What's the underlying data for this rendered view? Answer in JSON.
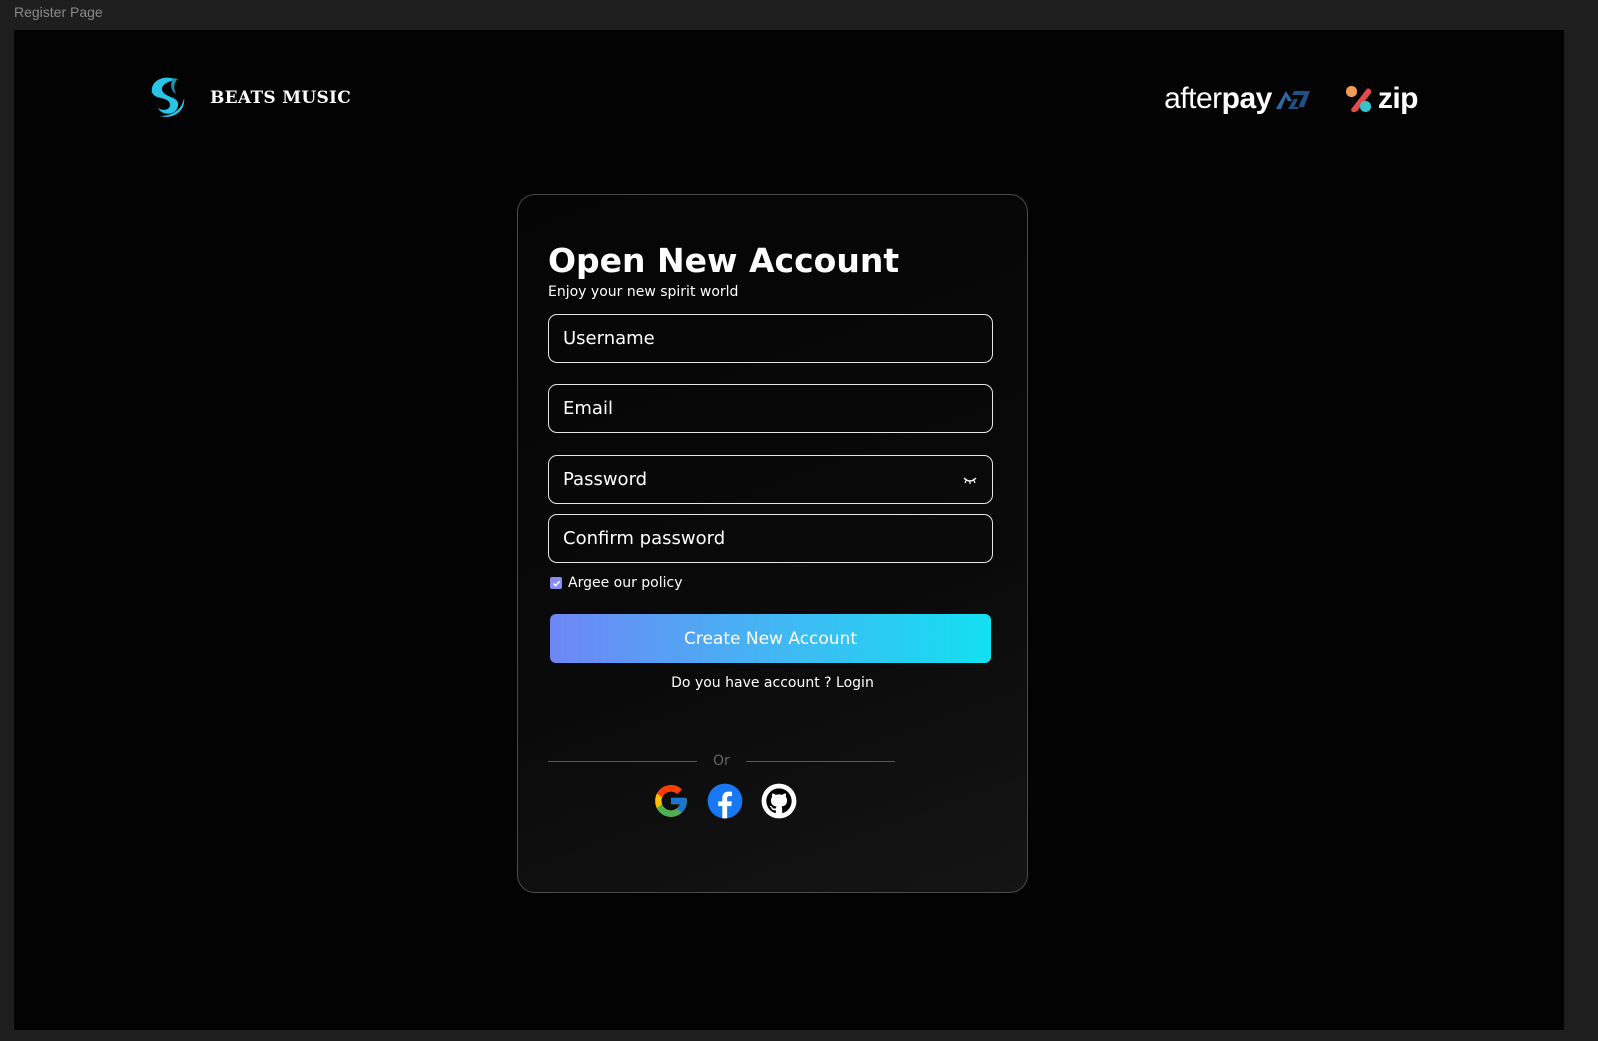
{
  "frame": {
    "label": "Register Page"
  },
  "header": {
    "brand_name": "BEATS MUSIC",
    "afterpay": {
      "part1": "after",
      "part2": "pay"
    },
    "zip": {
      "text": "zip"
    }
  },
  "form": {
    "title": "Open New Account",
    "subtitle": "Enjoy your new spirit world",
    "username_placeholder": "Username",
    "email_placeholder": "Email",
    "password_placeholder": "Password",
    "confirm_placeholder": "Confirm password",
    "policy_label": "Argee our policy",
    "policy_checked": true,
    "submit_label": "Create New Account",
    "login_prompt": "Do you have account ?",
    "login_link": "Login",
    "divider_label": "Or"
  },
  "social": [
    {
      "name": "google-icon"
    },
    {
      "name": "facebook-icon"
    },
    {
      "name": "github-icon"
    }
  ],
  "colors": {
    "background": "#030303",
    "accent_start": "#6e86f5",
    "accent_end": "#12e0f0",
    "checkbox": "#8b8cf0",
    "logo": "#29c5e6"
  }
}
